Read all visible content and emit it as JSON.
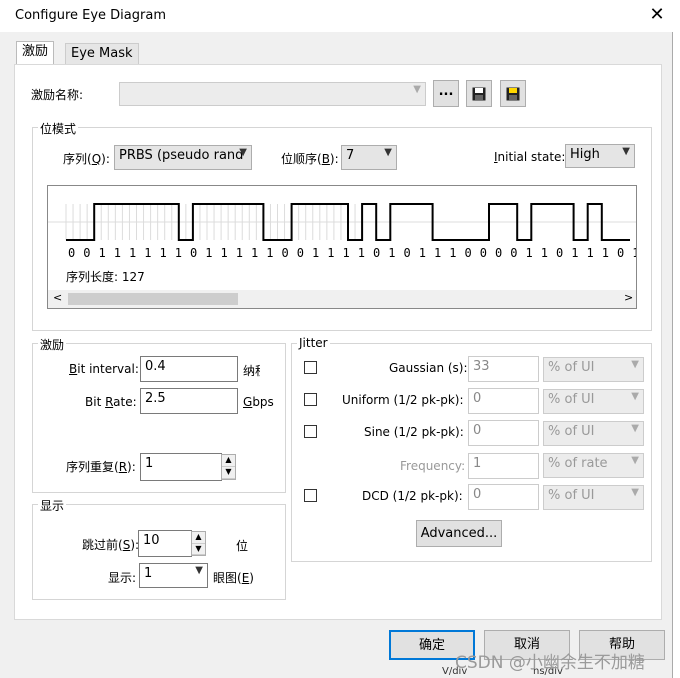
{
  "window": {
    "title": "Configure Eye Diagram",
    "close_glyph": "✕"
  },
  "tabs": [
    {
      "label": "激励"
    },
    {
      "label": "Eye Mask"
    }
  ],
  "stimulus_name": {
    "label": "激励名称:",
    "value": "",
    "browse_label": "..."
  },
  "bit_pattern": {
    "group_title": "位模式",
    "sequence_label_pre": "序列(",
    "sequence_key": "Q",
    "sequence_label_post": "):",
    "sequence_value": "PRBS (pseudo rand",
    "bit_order_pre": "位顺序(",
    "bit_order_key": "B",
    "bit_order_post": "):",
    "bit_order_value": "7",
    "initial_state_key": "I",
    "initial_state_rest": "nitial state:",
    "initial_state_value": "High",
    "bits": "0 0 1 1 1 1 1 1 0 1 1 1 1 1 0 0 1 1 1 1 0 1 0 1 1 1 0 0 0 0 1 1 0 1 1 1 0 1 0 0",
    "bit_values": [
      0,
      0,
      1,
      1,
      1,
      1,
      1,
      1,
      0,
      1,
      1,
      1,
      1,
      1,
      0,
      0,
      1,
      1,
      1,
      1,
      0,
      1,
      0,
      1,
      1,
      1,
      0,
      0,
      0,
      0,
      1,
      1,
      0,
      1,
      1,
      1,
      0,
      1,
      0,
      0
    ],
    "sequence_length": "序列长度: 127"
  },
  "stimulus": {
    "group_title": "激励",
    "bit_interval_key": "B",
    "bit_interval_rest": "it interval:",
    "bit_interval_value": "0.4",
    "bit_interval_unit": "纳秒",
    "bit_rate_pre": "Bit ",
    "bit_rate_key": "R",
    "bit_rate_rest": "ate:",
    "bit_rate_value": "2.5",
    "bit_rate_unit_key": "G",
    "bit_rate_unit_rest": "bps",
    "repeat_pre": "序列重复(",
    "repeat_key": "R",
    "repeat_post": "):",
    "repeat_value": "1"
  },
  "display": {
    "group_title": "显示",
    "skip_pre": "跳过前(",
    "skip_key": "S",
    "skip_post": "):",
    "skip_value": "10",
    "skip_unit": "位",
    "show_label": "显示:",
    "show_value": "1",
    "eye_pre": "眼图(",
    "eye_key": "E",
    "eye_post": ")"
  },
  "jitter": {
    "group_title": "Jitter",
    "rows": [
      {
        "label": "Gaussian (s):",
        "value": "33",
        "unit": "% of UI"
      },
      {
        "label": "Uniform (1/2 pk-pk):",
        "value": "0",
        "unit": "% of UI"
      },
      {
        "label": "Sine (1/2 pk-pk):",
        "value": "0",
        "unit": "% of UI"
      },
      {
        "label": "Frequency:",
        "value": "1",
        "unit": "% of rate"
      },
      {
        "label": "DCD (1/2 pk-pk):",
        "value": "0",
        "unit": "% of UI"
      }
    ],
    "advanced_label": "Advanced..."
  },
  "footer": {
    "ok": "确定",
    "cancel": "取消",
    "help": "帮助"
  },
  "background": {
    "bottom_text_1": "V/div",
    "bottom_text_2": "ns/div",
    "watermark": "CSDN @小幽余生不加糖"
  }
}
